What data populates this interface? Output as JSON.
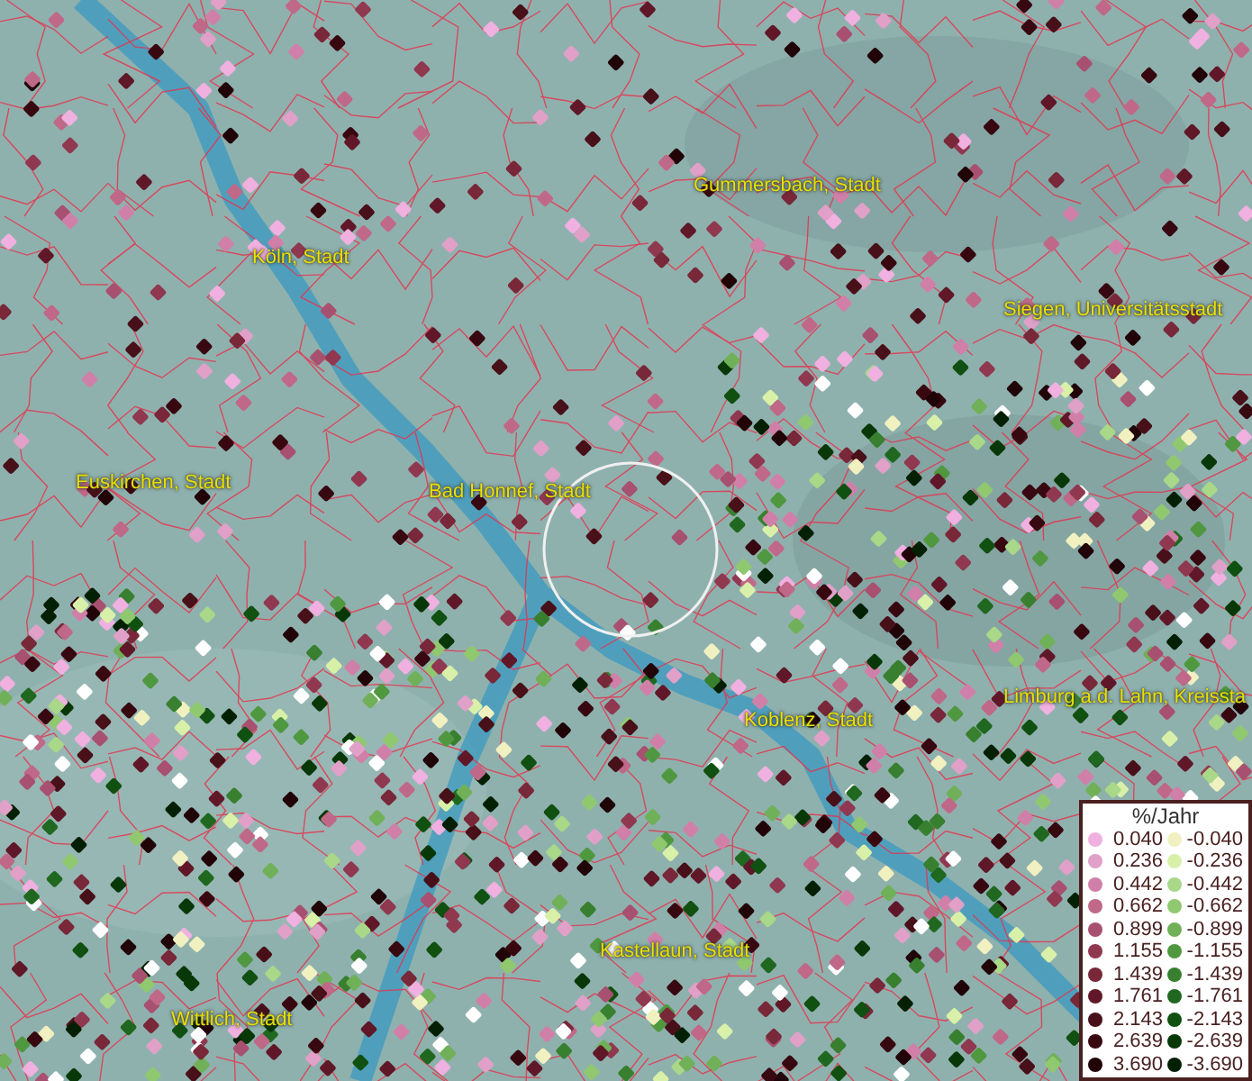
{
  "map_labels": [
    "Köln, Stadt",
    "Gummersbach, Stadt",
    "Siegen, Universitätsstadt",
    "Euskirchen, Stadt",
    "Bad Honnef, Stadt",
    "Koblenz, Stadt",
    "Limburg a.d. Lahn, Kreissta",
    "Kastellaun, Stadt",
    "Wittlich, Stadt"
  ],
  "legend": {
    "title": "%/Jahr",
    "positive": [
      {
        "label": "0.040",
        "color": "#f0b0e0"
      },
      {
        "label": "0.236",
        "color": "#e0a0c8"
      },
      {
        "label": "0.442",
        "color": "#d080a8"
      },
      {
        "label": "0.662",
        "color": "#c06888"
      },
      {
        "label": "0.899",
        "color": "#a85070"
      },
      {
        "label": "1.155",
        "color": "#903850"
      },
      {
        "label": "1.439",
        "color": "#782838"
      },
      {
        "label": "1.761",
        "color": "#601828"
      },
      {
        "label": "2.143",
        "color": "#481018"
      },
      {
        "label": "2.639",
        "color": "#380810"
      },
      {
        "label": "3.690",
        "color": "#200408"
      }
    ],
    "negative": [
      {
        "label": "-0.040",
        "color": "#f0f0c0"
      },
      {
        "label": "-0.236",
        "color": "#d8f0a8"
      },
      {
        "label": "-0.442",
        "color": "#a8d888"
      },
      {
        "label": "-0.662",
        "color": "#90c870"
      },
      {
        "label": "-0.899",
        "color": "#70b058"
      },
      {
        "label": "-1.155",
        "color": "#509840"
      },
      {
        "label": "-1.439",
        "color": "#388030"
      },
      {
        "label": "-1.761",
        "color": "#206820"
      },
      {
        "label": "-2.143",
        "color": "#105010"
      },
      {
        "label": "-2.639",
        "color": "#083808"
      },
      {
        "label": "-3.690",
        "color": "#042004"
      }
    ]
  }
}
